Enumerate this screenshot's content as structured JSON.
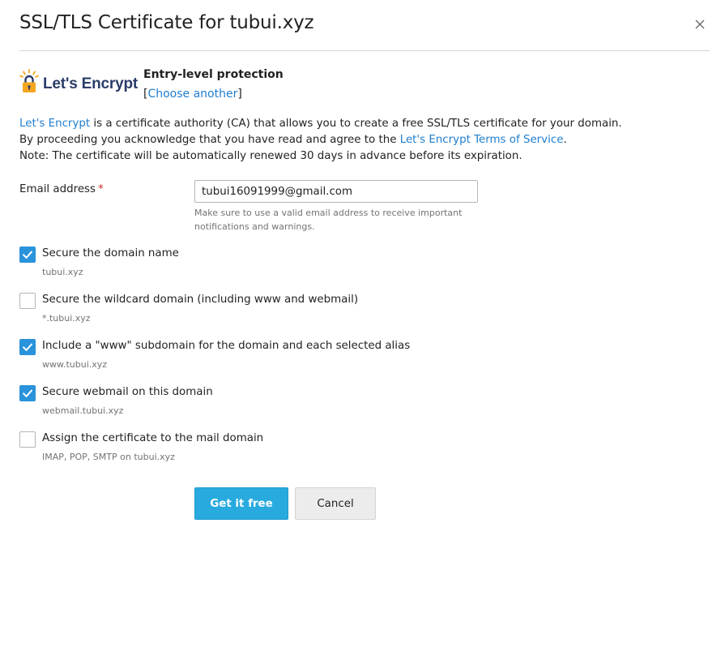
{
  "dialog": {
    "title": "SSL/TLS Certificate for tubui.xyz"
  },
  "provider": {
    "logo_text": "Let's Encrypt",
    "level": "Entry-level protection",
    "choose_open": "[",
    "choose_link": "Choose another",
    "choose_close": "]"
  },
  "description": {
    "line1_link": "Let's Encrypt",
    "line1_rest": " is a certificate authority (CA) that allows you to create a free SSL/TLS certificate for your domain.",
    "line2_start": "By proceeding you acknowledge that you have read and agree to the ",
    "line2_link": "Let's Encrypt Terms of Service",
    "line2_end": ".",
    "line3": "Note: The certificate will be automatically renewed 30 days in advance before its expiration."
  },
  "email": {
    "label": "Email address",
    "required": "*",
    "value": "tubui16091999@gmail.com",
    "hint": "Make sure to use a valid email address to receive important notifications and warnings."
  },
  "options": [
    {
      "label": "Secure the domain name",
      "sub": "tubui.xyz",
      "checked": true
    },
    {
      "label": "Secure the wildcard domain (including www and webmail)",
      "sub": "*.tubui.xyz",
      "checked": false
    },
    {
      "label": "Include a \"www\" subdomain for the domain and each selected alias",
      "sub": "www.tubui.xyz",
      "checked": true
    },
    {
      "label": "Secure webmail on this domain",
      "sub": "webmail.tubui.xyz",
      "checked": true
    },
    {
      "label": "Assign the certificate to the mail domain",
      "sub": "IMAP, POP, SMTP on tubui.xyz",
      "checked": false
    }
  ],
  "buttons": {
    "submit": "Get it free",
    "cancel": "Cancel"
  },
  "colors": {
    "accent": "#28aade",
    "checkbox": "#2993db",
    "link": "#1f7ed0",
    "required": "#d02b2b",
    "logo_text": "#2c3c69",
    "logo_padlock": "#f5a722"
  }
}
